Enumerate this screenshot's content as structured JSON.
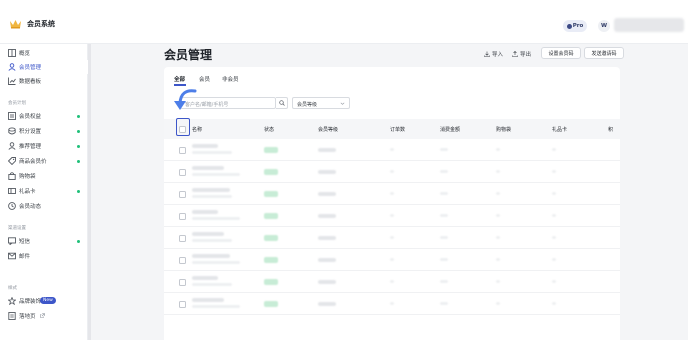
{
  "app": {
    "title": "会员系统",
    "plan_badge": "Pro",
    "avatar_letter": "W"
  },
  "sidebar": {
    "items": [
      {
        "label": "概览",
        "icon": "grid-icon",
        "active": false,
        "dot": false
      },
      {
        "label": "会员管理",
        "icon": "user-icon",
        "active": true,
        "dot": false
      },
      {
        "label": "数据看板",
        "icon": "chart-icon",
        "active": false,
        "dot": false
      }
    ],
    "groups": [
      {
        "title": "会员计划",
        "items": [
          {
            "label": "会员权益",
            "icon": "card-icon",
            "dot": true
          },
          {
            "label": "积分设置",
            "icon": "coins-icon",
            "dot": true
          },
          {
            "label": "推荐管理",
            "icon": "user-icon",
            "dot": true
          },
          {
            "label": "商品会员价",
            "icon": "tag-icon",
            "dot": true
          },
          {
            "label": "购物袋",
            "icon": "bag-icon",
            "dot": false
          },
          {
            "label": "礼品卡",
            "icon": "gift-card-icon",
            "dot": true
          },
          {
            "label": "会员动态",
            "icon": "clock-icon",
            "dot": false
          }
        ]
      },
      {
        "title": "渠道设置",
        "items": [
          {
            "label": "短信",
            "icon": "message-icon",
            "dot": true
          },
          {
            "label": "邮件",
            "icon": "mail-icon",
            "dot": false
          }
        ]
      },
      {
        "title": "样式",
        "items": [
          {
            "label": "品牌装饰",
            "icon": "star-icon",
            "dot": false,
            "badge": "New"
          },
          {
            "label": "落地页",
            "icon": "page-icon",
            "dot": false,
            "external": true
          }
        ]
      }
    ]
  },
  "header": {
    "title": "会员管理",
    "import_label": "导入",
    "export_label": "导出",
    "set_level_label": "设置会员码",
    "send_invite_label": "发送邀请码"
  },
  "tabs": [
    "全部",
    "会员",
    "非会员"
  ],
  "filters": {
    "search_placeholder": "客户名/邮箱/手机号",
    "level_placeholder": "会员等级"
  },
  "table": {
    "columns": [
      "名称",
      "状态",
      "会员等级",
      "订单数",
      "消费金额",
      "购物袋",
      "礼品卡",
      "积"
    ],
    "row_count": 8
  },
  "colors": {
    "accent": "#3d56c9",
    "status_green": "#21c07a"
  }
}
